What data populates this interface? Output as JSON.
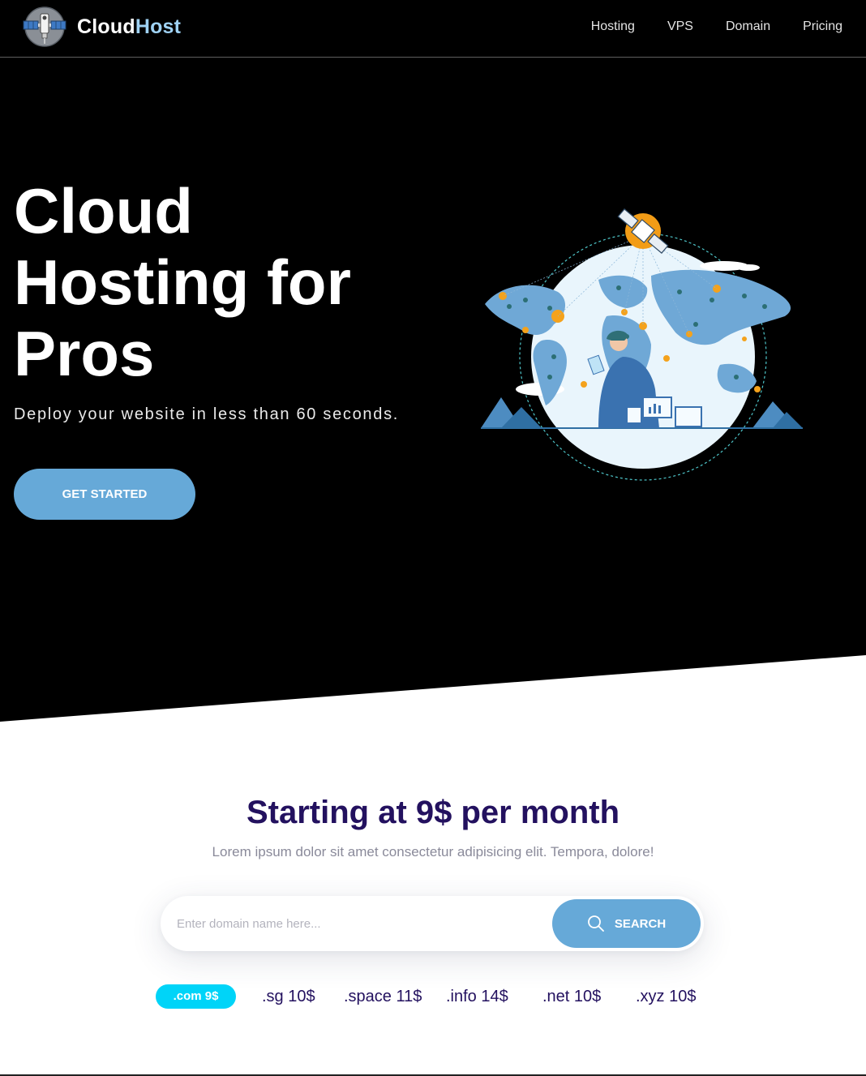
{
  "brand": {
    "name_part1": "Cloud",
    "name_part2": "Host",
    "logo_icon": "satellite-logo-icon"
  },
  "nav": {
    "items": [
      {
        "label": "Hosting"
      },
      {
        "label": "VPS"
      },
      {
        "label": "Domain"
      },
      {
        "label": "Pricing"
      }
    ]
  },
  "hero": {
    "title": "Cloud Hosting for Pros",
    "subtitle": "Deploy your website in less than 60 seconds.",
    "cta_label": "GET STARTED",
    "illustration": "world-map-satellite-illustration"
  },
  "pricing": {
    "heading": "Starting at 9$ per month",
    "subheading": "Lorem ipsum dolor sit amet consectetur adipisicing elit. Tempora, dolore!",
    "search": {
      "placeholder": "Enter domain name here...",
      "value": "",
      "button_label": "SEARCH",
      "icon": "search-icon"
    },
    "tlds": [
      {
        "label": ".com 9$"
      },
      {
        "label": ".sg 10$"
      },
      {
        "label": ".space 11$"
      },
      {
        "label": ".info 14$"
      },
      {
        "label": ".net 10$"
      },
      {
        "label": ".xyz 10$"
      }
    ]
  },
  "colors": {
    "accent": "#66a9d8",
    "heading": "#23115f",
    "active_tld": "#00d4f8",
    "brand_accent": "#9fd2f4"
  }
}
